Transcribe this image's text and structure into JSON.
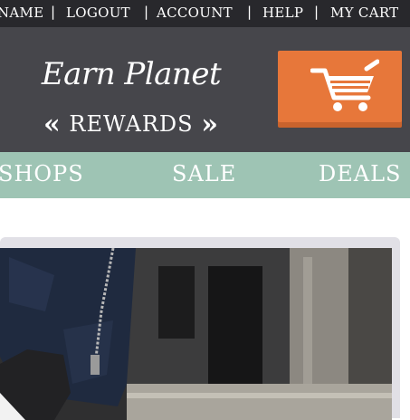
{
  "top_links": {
    "name": "NAME",
    "logout": "LOGOUT",
    "account": "ACCOUNT",
    "help": "HELP",
    "my_cart": "MY CART",
    "separator": "|"
  },
  "logo": {
    "name": "Earn Planet",
    "sub": "REWARDS",
    "chev_left": "«",
    "chev_right": "»"
  },
  "cart_button": {
    "icon": "shopping-cart-icon"
  },
  "nav": {
    "items": [
      "SHOPS",
      "SALE",
      "DEALS"
    ]
  },
  "colors": {
    "topbar": "#28282c",
    "header": "#46464b",
    "cart_accent": "#e7773a",
    "nav": "#9ec4b4",
    "hero_frame": "#e1e0e6"
  }
}
